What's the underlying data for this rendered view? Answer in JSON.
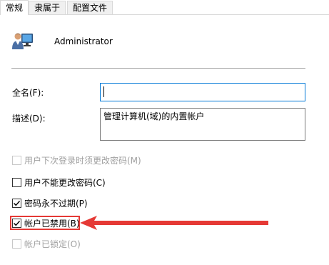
{
  "tabs": [
    {
      "label": "常规",
      "active": true
    },
    {
      "label": "隶属于",
      "active": false
    },
    {
      "label": "配置文件",
      "active": false
    }
  ],
  "user": {
    "name": "Administrator",
    "icon": "user-monitor-icon"
  },
  "fields": {
    "fullname_label": "全名(F):",
    "fullname_value": "",
    "description_label": "描述(D):",
    "description_value": "管理计算机(域)的内置帐户"
  },
  "checkboxes": [
    {
      "label": "用户下次登录时须更改密码(M)",
      "checked": false,
      "enabled": false
    },
    {
      "label": "用户不能更改密码(C)",
      "checked": false,
      "enabled": true
    },
    {
      "label": "密码永不过期(P)",
      "checked": true,
      "enabled": true
    },
    {
      "label": "帐户已禁用(B)",
      "checked": true,
      "enabled": true
    },
    {
      "label": "帐户已锁定(O)",
      "checked": false,
      "enabled": false
    }
  ],
  "colors": {
    "accent_focus": "#0078d7",
    "annotation_red": "#e53935"
  }
}
